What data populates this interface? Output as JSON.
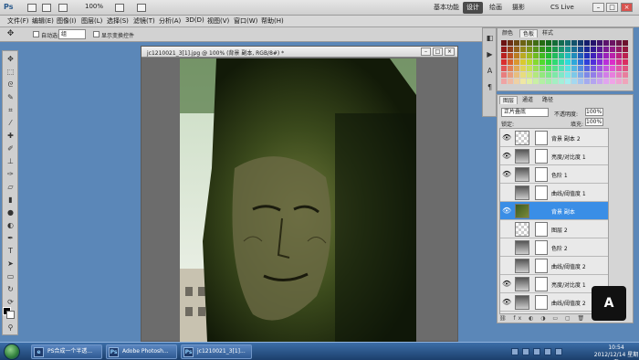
{
  "app": {
    "logo": "Ps",
    "zoom": "100%",
    "workspaces": [
      "基本功能",
      "设计",
      "绘画",
      "摄影"
    ],
    "active_workspace": "设计",
    "cs_live": "CS Live"
  },
  "menu": [
    "文件(F)",
    "编辑(E)",
    "图像(I)",
    "图层(L)",
    "选择(S)",
    "滤镜(T)",
    "分析(A)",
    "3D(D)",
    "视图(V)",
    "窗口(W)",
    "帮助(H)"
  ],
  "options": {
    "sample_label": "自动选择:",
    "sample_value": "组",
    "transform_label": "显示变换控件"
  },
  "document": {
    "title": "jc1210021_3[1].jpg @ 100% (背景 副本, RGB/8#) *",
    "status": ""
  },
  "swatches": {
    "tabs": [
      "颜色",
      "色板",
      "样式"
    ]
  },
  "layers": {
    "tabs": [
      "图层",
      "通道",
      "路径"
    ],
    "blend_mode": "正片叠底",
    "opacity_label": "不透明度:",
    "opacity_value": "100%",
    "lock_label": "锁定:",
    "fill_label": "填充:",
    "fill_value": "100%",
    "items": [
      {
        "name": "背景 副本 2",
        "visible": true,
        "type": "pixel"
      },
      {
        "name": "亮度/对比度 1",
        "visible": true,
        "type": "adjust"
      },
      {
        "name": "色阶 1",
        "visible": true,
        "type": "adjust"
      },
      {
        "name": "曲线/阈值度 1",
        "visible": false,
        "type": "adjust"
      },
      {
        "name": "背景 副本",
        "visible": true,
        "type": "photo",
        "selected": true
      },
      {
        "name": "图层 2",
        "visible": false,
        "type": "pixel"
      },
      {
        "name": "色阶 2",
        "visible": false,
        "type": "adjust"
      },
      {
        "name": "曲线/阈值度 2",
        "visible": false,
        "type": "adjust"
      },
      {
        "name": "亮度/对比度 1",
        "visible": true,
        "type": "adjust"
      },
      {
        "name": "曲线/阈值度 2",
        "visible": true,
        "type": "adjust"
      }
    ]
  },
  "taskbar": {
    "tasks": [
      {
        "label": "PS合成一个半透...",
        "icon": "ie-icon"
      },
      {
        "label": "Adobe Photosh...",
        "icon": "ps-icon"
      },
      {
        "label": "jc1210021_3[1]...",
        "icon": "ps-icon"
      }
    ],
    "time": "10:54",
    "date": "2012/12/14 星期五"
  },
  "watermark": "A"
}
